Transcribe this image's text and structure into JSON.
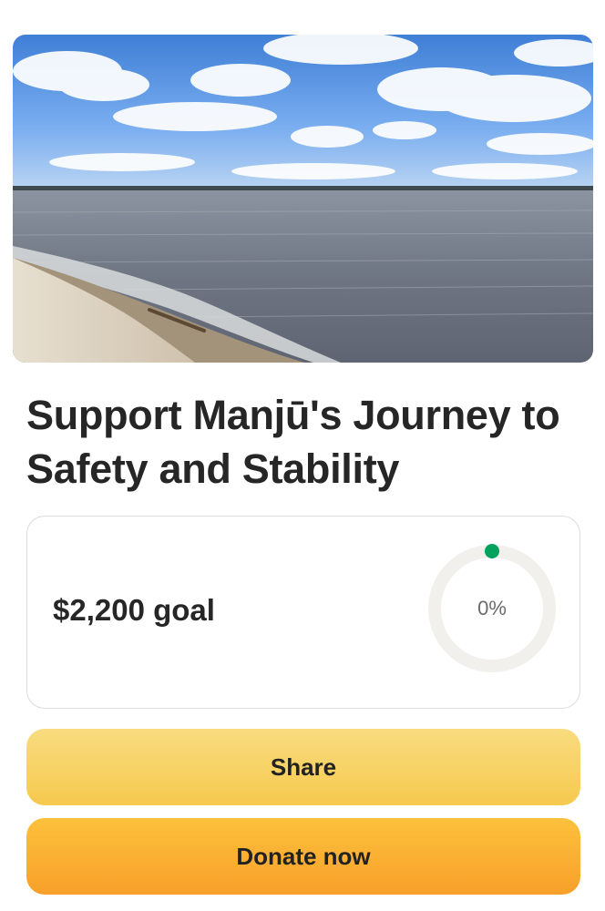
{
  "hero": {
    "image": "lake-shore-photo"
  },
  "campaign": {
    "title": "Support Manjū's Journey to Safety and Stability",
    "goal_label": "$2,200 goal",
    "progress_percent": 0,
    "progress_label": "0%",
    "progress_color": "#00a25e",
    "track_color": "#f1f0ec"
  },
  "actions": {
    "share_label": "Share",
    "donate_label": "Donate now"
  }
}
